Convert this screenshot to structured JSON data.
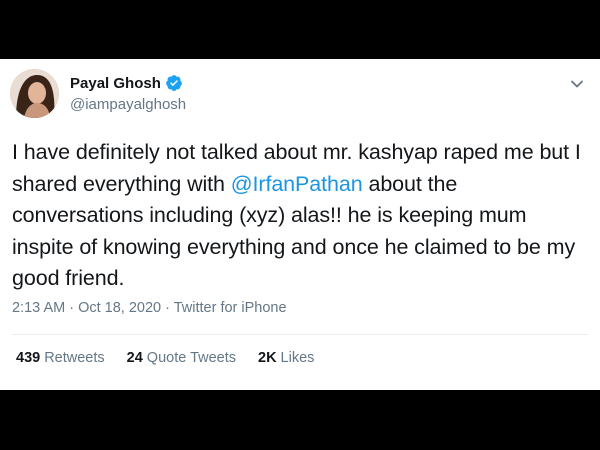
{
  "tweet": {
    "author": {
      "display_name": "Payal Ghosh",
      "handle": "@iampayalghosh",
      "verified": true
    },
    "text_parts": [
      "I have definitely not talked about mr. kashyap raped me but I shared everything with ",
      "@IrfanPathan",
      " about the conversations including (xyz) alas!! he is keeping mum inspite of knowing everything and once he claimed to be my good friend."
    ],
    "meta": "2:13 AM · Oct 18, 2020 · Twitter for iPhone",
    "stats": [
      {
        "count": "439",
        "label": "Retweets"
      },
      {
        "count": "24",
        "label": "Quote Tweets"
      },
      {
        "count": "2K",
        "label": "Likes"
      }
    ]
  },
  "colors": {
    "accent": "#1b95e0",
    "text": "#14171a",
    "secondary": "#657786",
    "background": "#000000"
  },
  "icons": [
    "verified-badge-icon",
    "chevron-down-icon"
  ]
}
